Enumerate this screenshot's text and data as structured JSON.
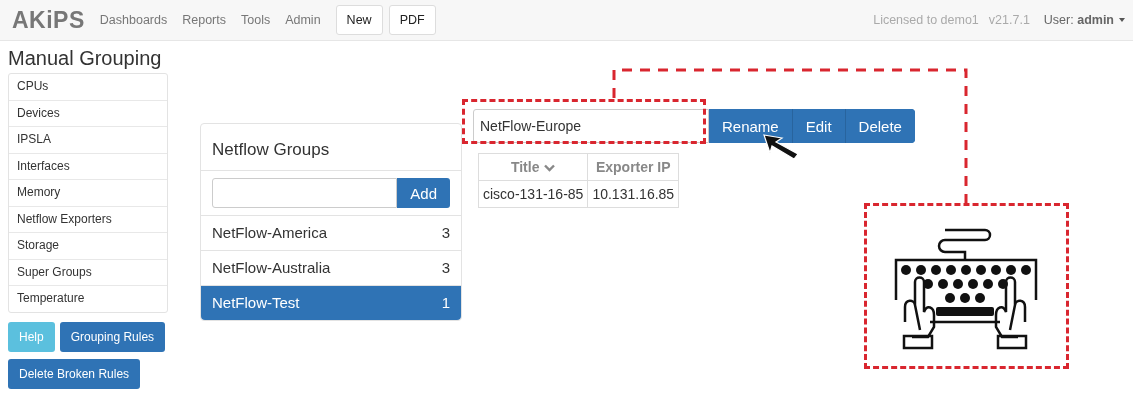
{
  "navbar": {
    "brand": "AKiPS",
    "menu": [
      "Dashboards",
      "Reports",
      "Tools",
      "Admin"
    ],
    "buttons": [
      "New",
      "PDF"
    ],
    "license": "Licensed to demo1",
    "version": "v21.7.1",
    "user_label": "User:",
    "user": "admin"
  },
  "page_title": "Manual Grouping",
  "sidebar": {
    "items": [
      "CPUs",
      "Devices",
      "IPSLA",
      "Interfaces",
      "Memory",
      "Netflow Exporters",
      "Storage",
      "Super Groups",
      "Temperature"
    ]
  },
  "sidebar_buttons": [
    {
      "label": "Help",
      "kind": "info"
    },
    {
      "label": "Grouping Rules",
      "kind": "primary"
    },
    {
      "label": "Delete Broken Rules",
      "kind": "primary"
    }
  ],
  "groups_panel": {
    "title": "Netflow Groups",
    "add_button": "Add",
    "groups": [
      {
        "name": "NetFlow-America",
        "count": "3",
        "selected": false
      },
      {
        "name": "NetFlow-Australia",
        "count": "3",
        "selected": false
      },
      {
        "name": "NetFlow-Test",
        "count": "1",
        "selected": true
      }
    ]
  },
  "group_toolbar": {
    "name_value": "NetFlow-Europe",
    "buttons": [
      "Rename",
      "Edit",
      "Delete"
    ]
  },
  "table": {
    "columns": [
      "Title",
      "Exporter IP"
    ],
    "rows": [
      [
        "cisco-131-16-85",
        "10.131.16.85"
      ]
    ]
  }
}
